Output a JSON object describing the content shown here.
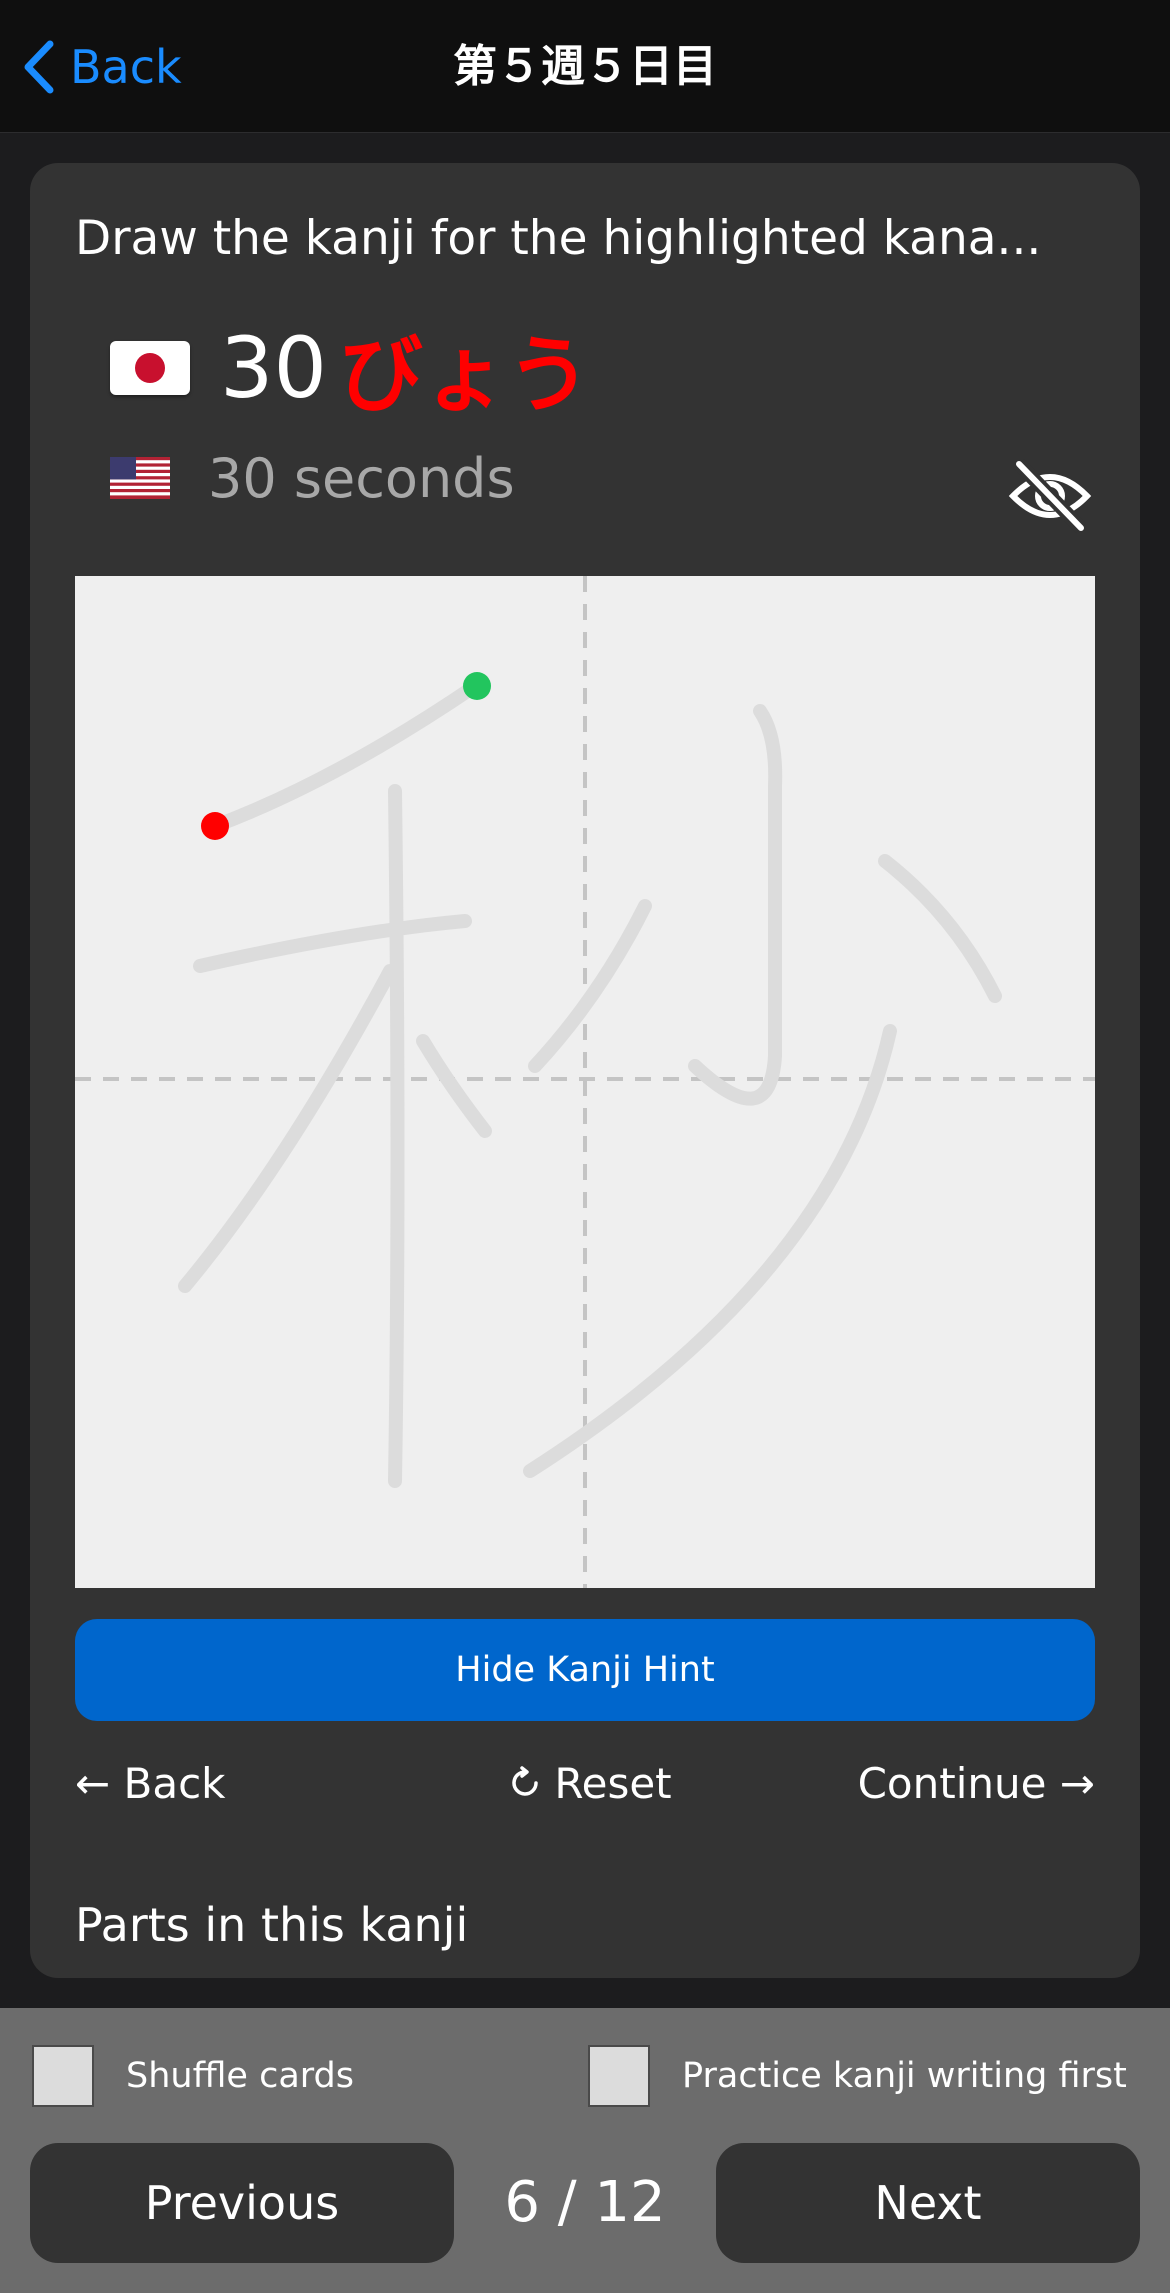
{
  "nav": {
    "back_label": "Back",
    "title": "第５週５日目"
  },
  "card": {
    "prompt": "Draw the kanji for the highlighted kana...",
    "japanese": {
      "number": "30",
      "kana": "びょう"
    },
    "english": "30 seconds",
    "hint_button": "Hide Kanji Hint",
    "actions": {
      "back": "← Back",
      "reset": "Reset",
      "continue": "Continue →"
    },
    "parts_title": "Parts in this kanji",
    "canvas": {
      "hint_kanji": "秒",
      "start_dot_color": "#22c55e",
      "end_dot_color": "#ff0000"
    }
  },
  "footer": {
    "shuffle_label": "Shuffle cards",
    "shuffle_checked": false,
    "practice_label": "Practice kanji writing first",
    "practice_checked": false,
    "previous_label": "Previous",
    "counter": "6 / 12",
    "next_label": "Next"
  },
  "colors": {
    "accent": "#1a8cff",
    "primary_button": "#0066cc",
    "kana_highlight": "#ff0000",
    "card_bg": "#333333"
  },
  "icons": [
    "chevron-left-icon",
    "flag-japan-icon",
    "flag-us-icon",
    "eye-slash-icon",
    "arrow-left-icon",
    "reset-icon",
    "arrow-right-icon"
  ]
}
